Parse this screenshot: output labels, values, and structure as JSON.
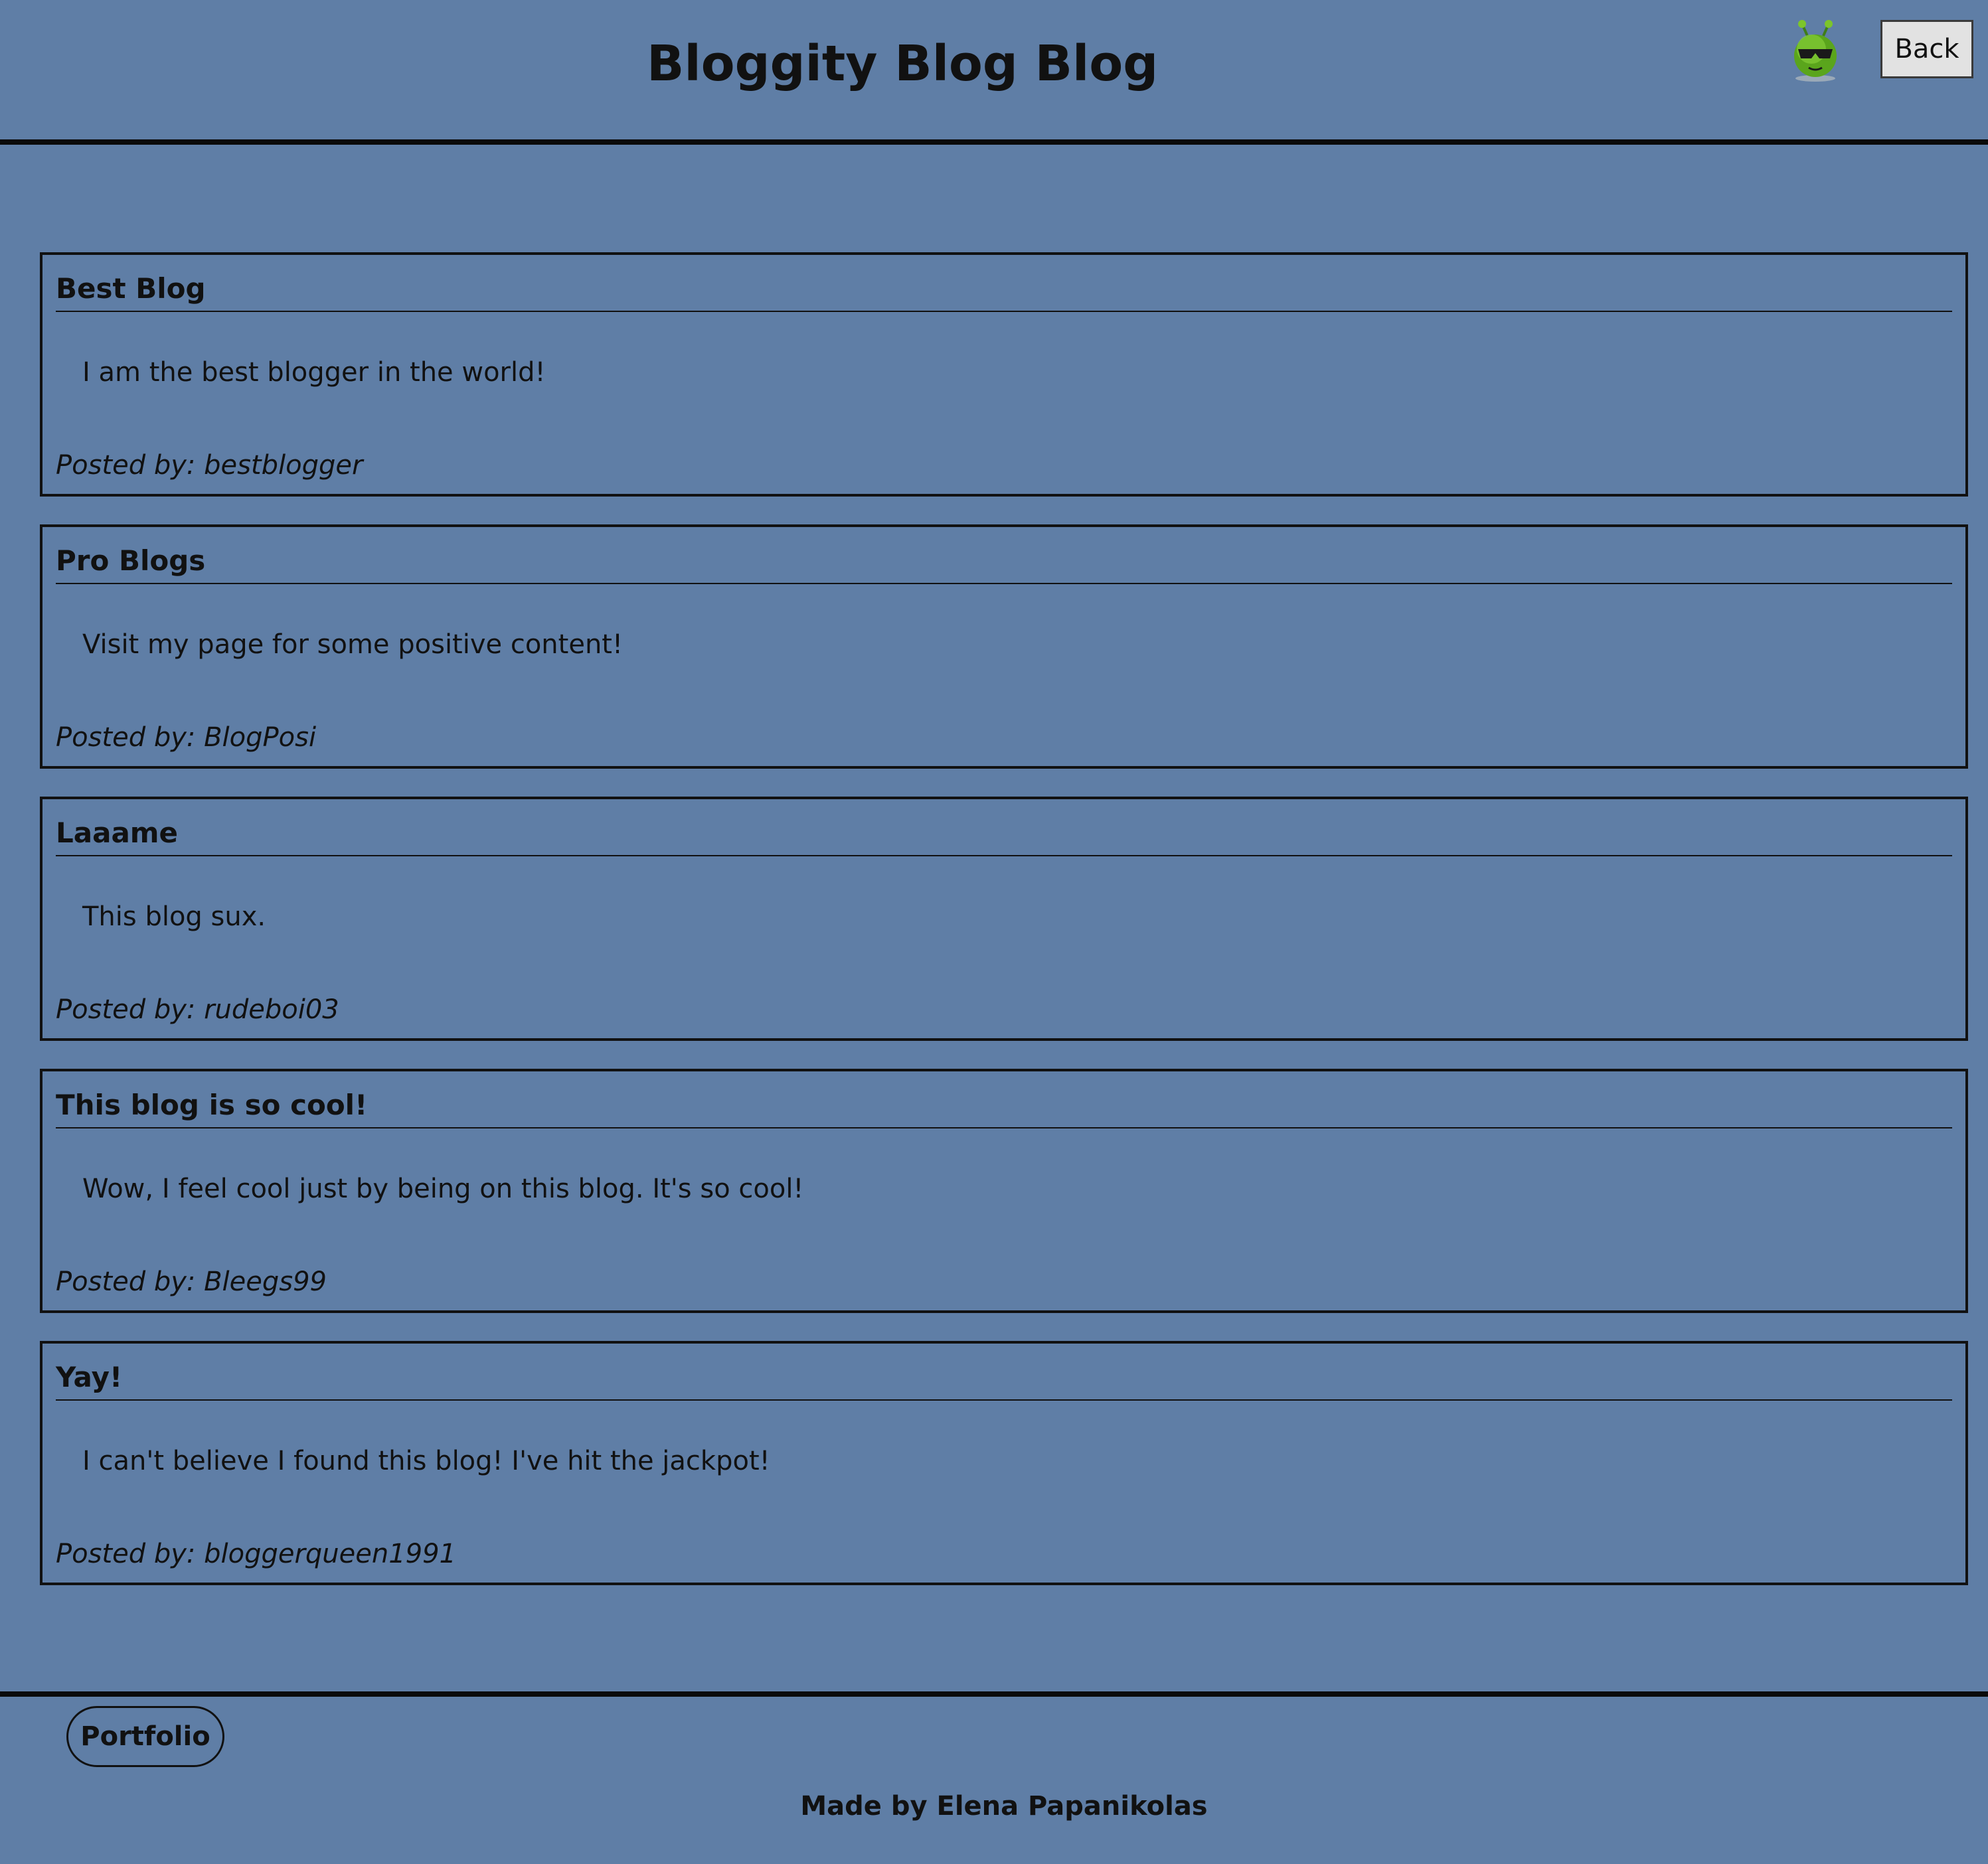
{
  "header": {
    "title": "Bloggity Blog Blog",
    "avatar_icon": "alien-face-icon",
    "back_label": "Back"
  },
  "posts": [
    {
      "title": "Best Blog",
      "body": "I am the best blogger in the world!",
      "author": "Posted by: bestblogger"
    },
    {
      "title": "Pro Blogs",
      "body": "Visit my page for some positive content!",
      "author": "Posted by: BlogPosi"
    },
    {
      "title": "Laaame",
      "body": "This blog sux.",
      "author": "Posted by: rudeboi03"
    },
    {
      "title": "This blog is so cool!",
      "body": "Wow, I feel cool just by being on this blog. It's so cool!",
      "author": "Posted by: Bleegs99"
    },
    {
      "title": "Yay!",
      "body": "I can't believe I found this blog! I've hit the jackpot!",
      "author": "Posted by: bloggerqueen1991"
    }
  ],
  "footer": {
    "portfolio_label": "Portfolio",
    "credit": "Made by Elena Papanikolas"
  },
  "colors": {
    "background": "#5f7ea6",
    "text": "#111111",
    "button_bg": "#e2e2e2"
  }
}
